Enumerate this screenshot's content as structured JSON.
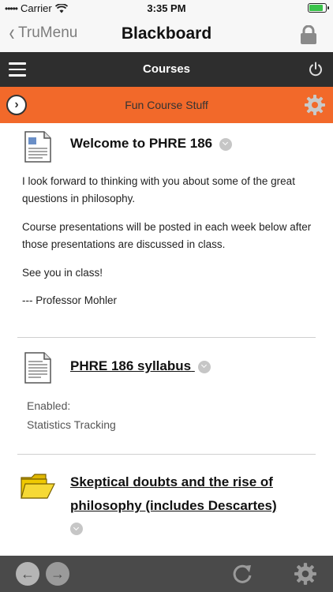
{
  "status_bar": {
    "carrier": "Carrier",
    "time": "3:35 PM"
  },
  "nav": {
    "back_label": "TruMenu",
    "title": "Blackboard"
  },
  "course_bar": {
    "title": "Courses"
  },
  "section_bar": {
    "title": "Fun Course Stuff"
  },
  "items": [
    {
      "title": "Welcome to PHRE 186",
      "paragraphs": [
        "I look forward to thinking with you about some of the great questions in philosophy.",
        "Course presentations will be posted in each week below after those presentations are discussed in class.",
        "See you in class!",
        "--- Professor Mohler"
      ]
    },
    {
      "title": "PHRE 186 syllabus",
      "meta": [
        "Enabled:",
        "Statistics Tracking"
      ]
    },
    {
      "title": "Skeptical doubts and the rise of philosophy (includes Descartes)"
    }
  ],
  "colors": {
    "orange": "#f2692a",
    "dark": "#2e2e2e",
    "toolbar": "#4a4a4a"
  },
  "icons": [
    "wifi-icon",
    "battery-icon",
    "chevron-left-icon",
    "lock-icon",
    "hamburger-icon",
    "power-icon",
    "arrow-right-circle-icon",
    "gear-icon",
    "document-icon",
    "folder-icon",
    "chevron-down-icon",
    "arrow-left-icon",
    "arrow-right-icon",
    "refresh-icon"
  ]
}
